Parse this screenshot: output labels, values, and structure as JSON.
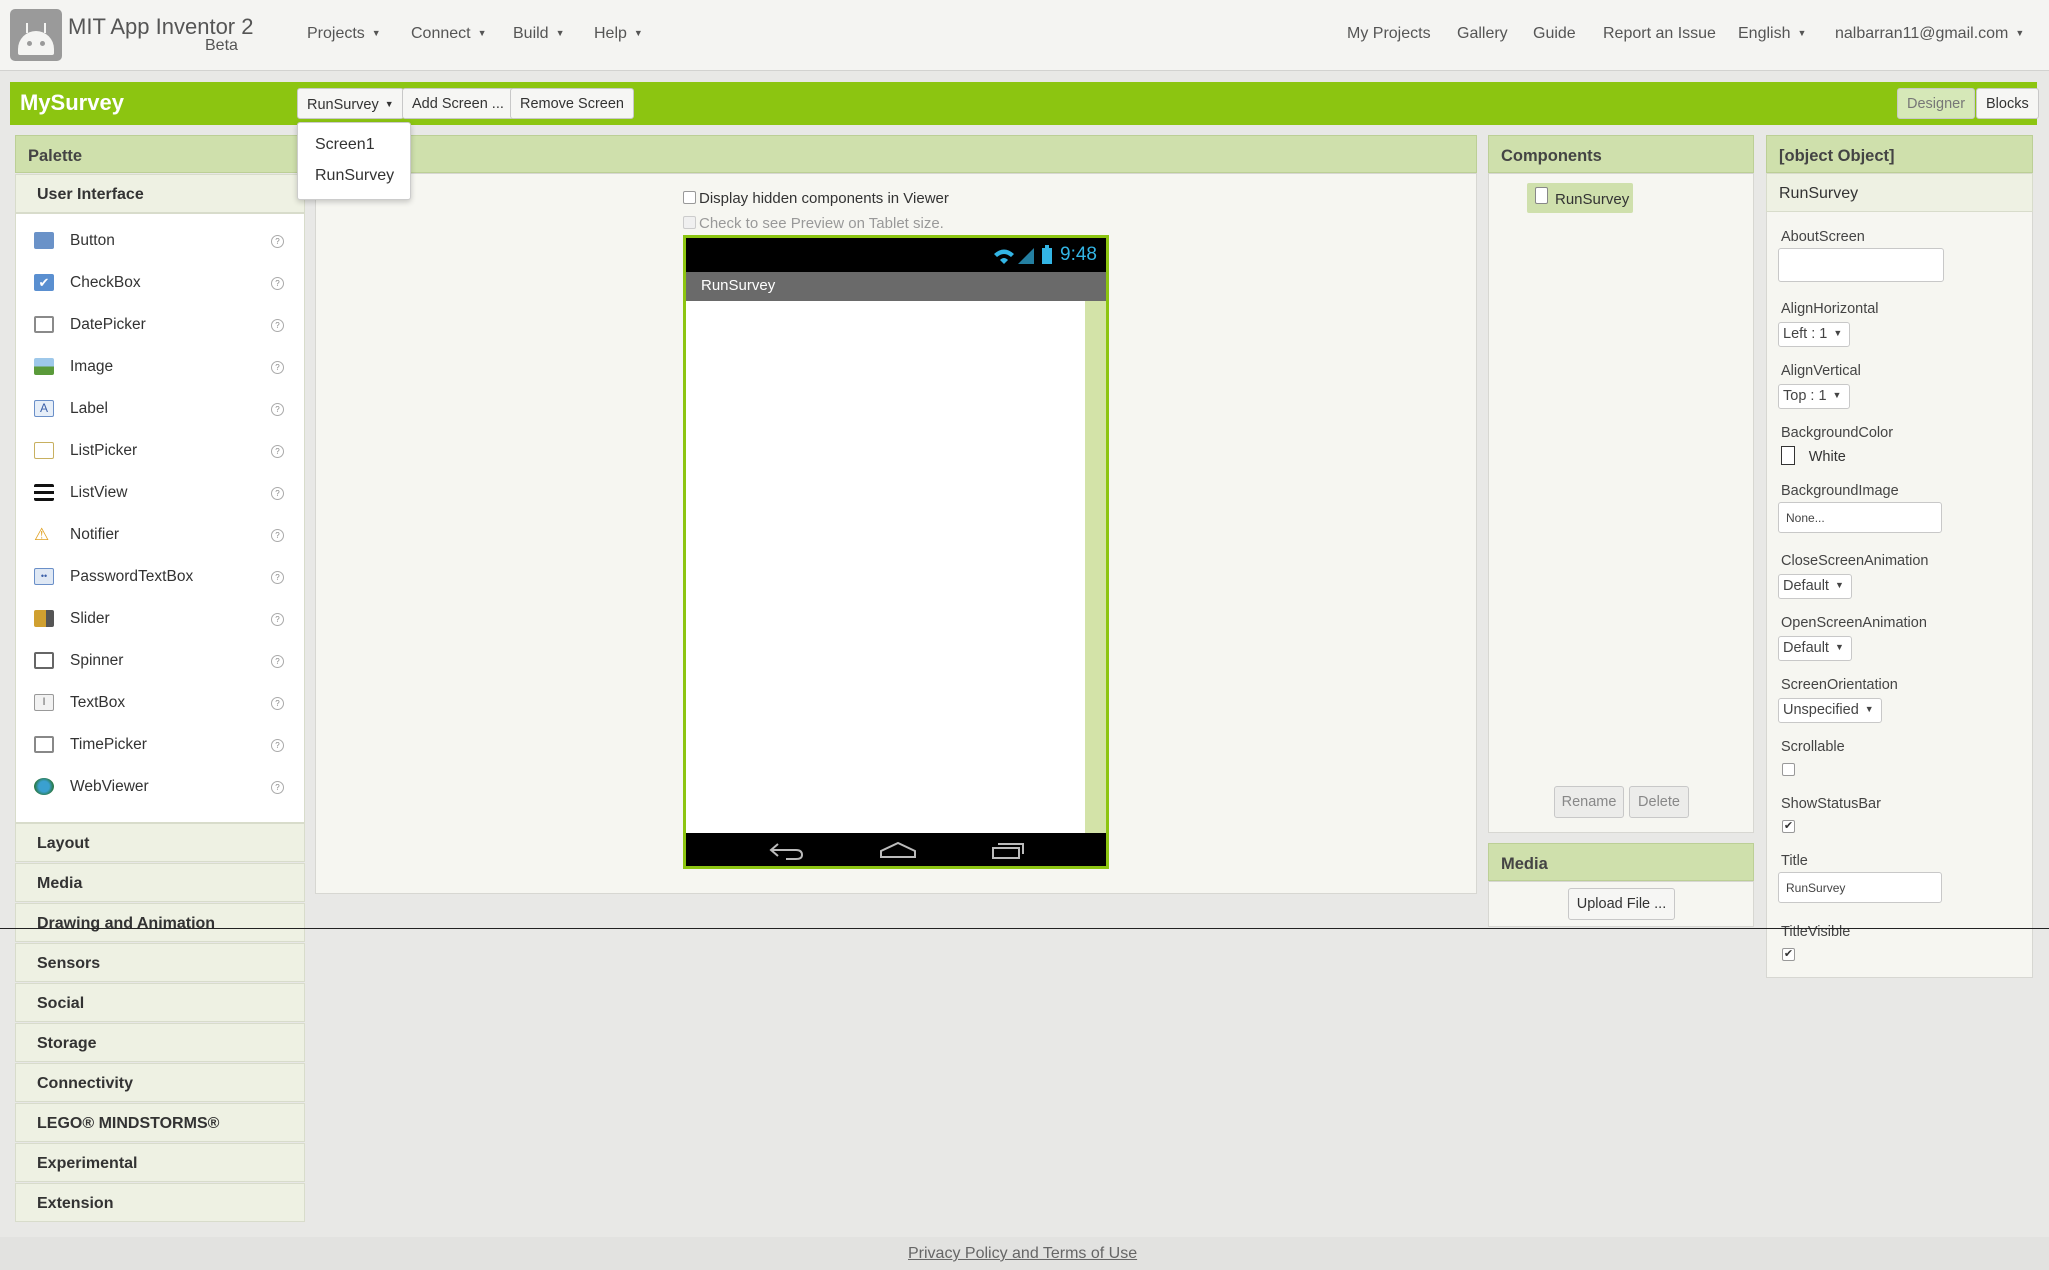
{
  "app": {
    "name": "MIT App Inventor 2",
    "badge": "Beta"
  },
  "nav_left": [
    {
      "label": "Projects",
      "caret": "▼"
    },
    {
      "label": "Connect",
      "caret": "▼"
    },
    {
      "label": "Build",
      "caret": "▼"
    },
    {
      "label": "Help",
      "caret": "▼"
    }
  ],
  "nav_right": [
    {
      "label": "My Projects"
    },
    {
      "label": "Gallery"
    },
    {
      "label": "Guide"
    },
    {
      "label": "Report an Issue"
    },
    {
      "label": "English",
      "caret": "▼"
    },
    {
      "label": "nalbarran11@gmail.com",
      "caret": "▼"
    }
  ],
  "project": {
    "name": "MySurvey",
    "screen_select": "RunSurvey",
    "add_screen": "Add Screen ...",
    "remove_screen": "Remove Screen",
    "designer": "Designer",
    "blocks": "Blocks"
  },
  "screen_menu": [
    "Screen1",
    "RunSurvey"
  ],
  "palette": {
    "title": "Palette",
    "open_category": "User Interface",
    "items": [
      {
        "label": "Button",
        "icon": "button-icon",
        "color": "#6a92c8"
      },
      {
        "label": "CheckBox",
        "icon": "checkbox-icon",
        "color": "#5a8fd0"
      },
      {
        "label": "DatePicker",
        "icon": "datepicker-icon",
        "color": "#8a8a8a"
      },
      {
        "label": "Image",
        "icon": "image-icon",
        "color": "#5a9a3a"
      },
      {
        "label": "Label",
        "icon": "label-icon",
        "color": "#6a8fc8"
      },
      {
        "label": "ListPicker",
        "icon": "listpicker-icon",
        "color": "#c8b060"
      },
      {
        "label": "ListView",
        "icon": "listview-icon",
        "color": "#111111"
      },
      {
        "label": "Notifier",
        "icon": "notifier-icon",
        "color": "#e0a020"
      },
      {
        "label": "PasswordTextBox",
        "icon": "passwordtextbox-icon",
        "color": "#6a8fc8"
      },
      {
        "label": "Slider",
        "icon": "slider-icon",
        "color": "#d0a030"
      },
      {
        "label": "Spinner",
        "icon": "spinner-icon",
        "color": "#666666"
      },
      {
        "label": "TextBox",
        "icon": "textbox-icon",
        "color": "#999999"
      },
      {
        "label": "TimePicker",
        "icon": "timepicker-icon",
        "color": "#888888"
      },
      {
        "label": "WebViewer",
        "icon": "webviewer-icon",
        "color": "#2a7a4a"
      }
    ],
    "help_glyph": "?",
    "categories": [
      "Layout",
      "Media",
      "Drawing and Animation",
      "Sensors",
      "Social",
      "Storage",
      "Connectivity",
      "LEGO® MINDSTORMS®",
      "Experimental",
      "Extension"
    ]
  },
  "viewer": {
    "hidden_components": "Display hidden components in Viewer",
    "tablet_preview": "Check to see Preview on Tablet size.",
    "clock": "9:48",
    "screen_title": "RunSurvey"
  },
  "components": {
    "title": "Components",
    "tree": [
      "RunSurvey"
    ],
    "rename": "Rename",
    "delete": "Delete"
  },
  "media": {
    "title": "Media",
    "upload": "Upload File ..."
  },
  "properties": {
    "title": {
      "label": "Title",
      "value": "RunSurvey"
    },
    "component": "RunSurvey",
    "about_screen": {
      "label": "AboutScreen",
      "value": ""
    },
    "align_horizontal": {
      "label": "AlignHorizontal",
      "value": "Left : 1"
    },
    "align_vertical": {
      "label": "AlignVertical",
      "value": "Top : 1"
    },
    "background_color": {
      "label": "BackgroundColor",
      "value": "White",
      "swatch": "#ffffff"
    },
    "background_image": {
      "label": "BackgroundImage",
      "value": "None..."
    },
    "close_animation": {
      "label": "CloseScreenAnimation",
      "value": "Default"
    },
    "open_animation": {
      "label": "OpenScreenAnimation",
      "value": "Default"
    },
    "orientation": {
      "label": "ScreenOrientation",
      "value": "Unspecified"
    },
    "scrollable": {
      "label": "Scrollable",
      "checked": false
    },
    "show_status_bar": {
      "label": "ShowStatusBar",
      "checked": true
    },
    "title_visible": {
      "label": "TitleVisible",
      "checked": true
    }
  },
  "footer": {
    "link": "Privacy Policy and Terms of Use"
  },
  "colors": {
    "brand_green": "#8cc511",
    "panel_header": "#cfe0ac"
  }
}
